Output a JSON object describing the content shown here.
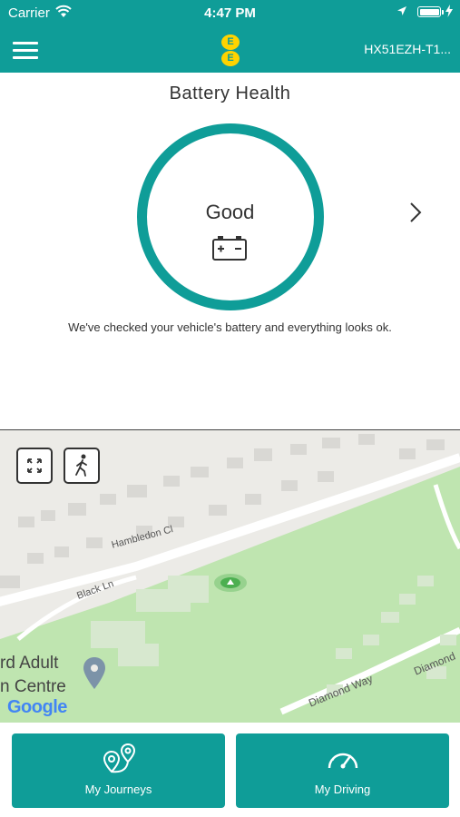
{
  "status_bar": {
    "carrier": "Carrier",
    "time": "4:47 PM"
  },
  "header": {
    "logo_letters": [
      "E",
      "E"
    ],
    "vehicle_id": "HX51EZH-T1..."
  },
  "battery": {
    "title": "Battery Health",
    "status": "Good",
    "message": "We've checked your vehicle's battery and everything looks ok."
  },
  "map": {
    "labels": {
      "street1": "Hambledon Cl",
      "street2": "Black Ln",
      "street3": "Diamond Way",
      "street4": "Diamond",
      "street5": "Black Ln"
    },
    "poi_line1": "rd Adult",
    "poi_line2": "n Centre",
    "attribution": "Google"
  },
  "tabs": [
    {
      "label": "My Journeys",
      "icon": "journeys-icon"
    },
    {
      "label": "My Driving",
      "icon": "speedometer-icon"
    }
  ],
  "colors": {
    "primary": "#0f9d98",
    "logo": "#ffd300",
    "park_green": "#bfe5b0",
    "location_green": "#4caf50"
  }
}
